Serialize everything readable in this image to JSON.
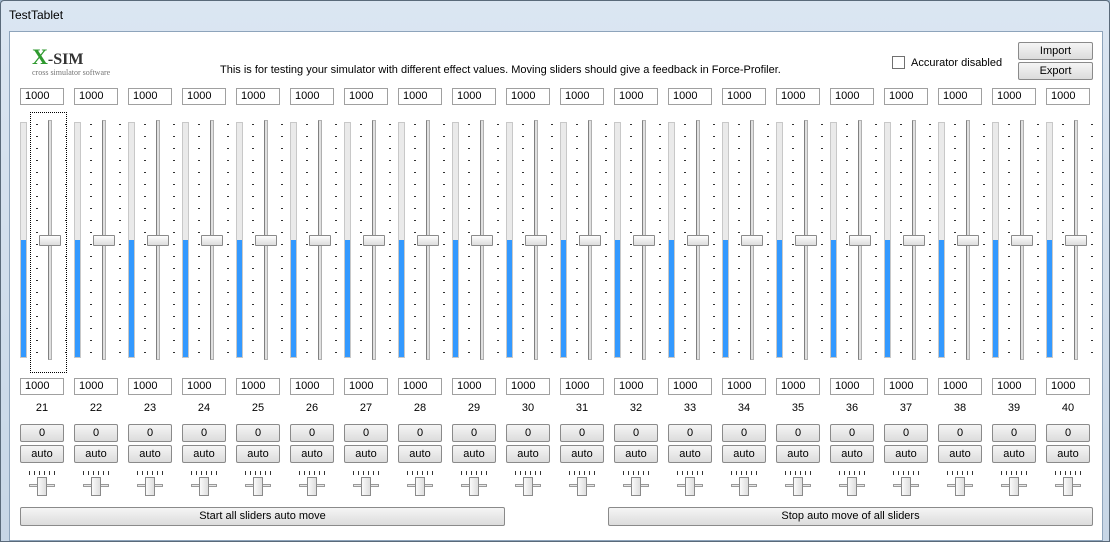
{
  "window": {
    "title": "TestTablet"
  },
  "logo": {
    "brand_x": "X",
    "brand_sim": "-SIM",
    "subtitle": "cross simulator software"
  },
  "header": {
    "info_text": "This is for testing your simulator with different effect values. Moving sliders should give a feedback in Force-Profiler.",
    "accurator_label": "Accurator disabled",
    "accurator_checked": false,
    "import_label": "Import",
    "export_label": "Export"
  },
  "colors": {
    "fill": "#3399ff",
    "focus": "#000000"
  },
  "channels": [
    {
      "top_value": "1000",
      "bottom_value": "1000",
      "number": "21",
      "level": 0.5,
      "zero_label": "0",
      "auto_label": "auto"
    },
    {
      "top_value": "1000",
      "bottom_value": "1000",
      "number": "22",
      "level": 0.5,
      "zero_label": "0",
      "auto_label": "auto"
    },
    {
      "top_value": "1000",
      "bottom_value": "1000",
      "number": "23",
      "level": 0.5,
      "zero_label": "0",
      "auto_label": "auto"
    },
    {
      "top_value": "1000",
      "bottom_value": "1000",
      "number": "24",
      "level": 0.5,
      "zero_label": "0",
      "auto_label": "auto"
    },
    {
      "top_value": "1000",
      "bottom_value": "1000",
      "number": "25",
      "level": 0.5,
      "zero_label": "0",
      "auto_label": "auto"
    },
    {
      "top_value": "1000",
      "bottom_value": "1000",
      "number": "26",
      "level": 0.5,
      "zero_label": "0",
      "auto_label": "auto"
    },
    {
      "top_value": "1000",
      "bottom_value": "1000",
      "number": "27",
      "level": 0.5,
      "zero_label": "0",
      "auto_label": "auto"
    },
    {
      "top_value": "1000",
      "bottom_value": "1000",
      "number": "28",
      "level": 0.5,
      "zero_label": "0",
      "auto_label": "auto"
    },
    {
      "top_value": "1000",
      "bottom_value": "1000",
      "number": "29",
      "level": 0.5,
      "zero_label": "0",
      "auto_label": "auto"
    },
    {
      "top_value": "1000",
      "bottom_value": "1000",
      "number": "30",
      "level": 0.5,
      "zero_label": "0",
      "auto_label": "auto"
    },
    {
      "top_value": "1000",
      "bottom_value": "1000",
      "number": "31",
      "level": 0.5,
      "zero_label": "0",
      "auto_label": "auto"
    },
    {
      "top_value": "1000",
      "bottom_value": "1000",
      "number": "32",
      "level": 0.5,
      "zero_label": "0",
      "auto_label": "auto"
    },
    {
      "top_value": "1000",
      "bottom_value": "1000",
      "number": "33",
      "level": 0.5,
      "zero_label": "0",
      "auto_label": "auto"
    },
    {
      "top_value": "1000",
      "bottom_value": "1000",
      "number": "34",
      "level": 0.5,
      "zero_label": "0",
      "auto_label": "auto"
    },
    {
      "top_value": "1000",
      "bottom_value": "1000",
      "number": "35",
      "level": 0.5,
      "zero_label": "0",
      "auto_label": "auto"
    },
    {
      "top_value": "1000",
      "bottom_value": "1000",
      "number": "36",
      "level": 0.5,
      "zero_label": "0",
      "auto_label": "auto"
    },
    {
      "top_value": "1000",
      "bottom_value": "1000",
      "number": "37",
      "level": 0.5,
      "zero_label": "0",
      "auto_label": "auto"
    },
    {
      "top_value": "1000",
      "bottom_value": "1000",
      "number": "38",
      "level": 0.5,
      "zero_label": "0",
      "auto_label": "auto"
    },
    {
      "top_value": "1000",
      "bottom_value": "1000",
      "number": "39",
      "level": 0.5,
      "zero_label": "0",
      "auto_label": "auto"
    },
    {
      "top_value": "1000",
      "bottom_value": "1000",
      "number": "40",
      "level": 0.5,
      "zero_label": "0",
      "auto_label": "auto"
    }
  ],
  "footer": {
    "start_label": "Start all sliders auto move",
    "stop_label": "Stop auto move of all sliders"
  }
}
